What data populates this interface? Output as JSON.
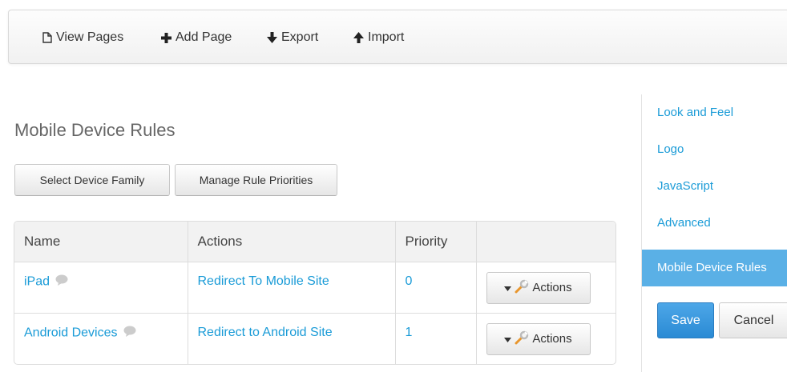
{
  "toolbar": {
    "view_pages": "View Pages",
    "add_page": "Add Page",
    "export": "Export",
    "import": "Import"
  },
  "page": {
    "title": "Mobile Device Rules",
    "select_device_family": "Select Device Family",
    "manage_rule_priorities": "Manage Rule Priorities"
  },
  "table": {
    "headers": [
      "Name",
      "Actions",
      "Priority",
      ""
    ],
    "rows": [
      {
        "name": "iPad",
        "action": "Redirect To Mobile Site",
        "priority": "0",
        "button": "Actions"
      },
      {
        "name": "Android Devices",
        "action": "Redirect to Android Site",
        "priority": "1",
        "button": "Actions"
      }
    ]
  },
  "sidebar": {
    "items": [
      {
        "label": "Look and Feel"
      },
      {
        "label": "Logo"
      },
      {
        "label": "JavaScript"
      },
      {
        "label": "Advanced"
      },
      {
        "label": "Mobile Device Rules",
        "active": true
      }
    ],
    "save": "Save",
    "cancel": "Cancel"
  },
  "colors": {
    "link": "#1a9bd7",
    "active_nav": "#5ab0e6",
    "primary_button": "#2a8ad4"
  },
  "icons": {
    "view_pages": "file-icon",
    "add_page": "plus-icon",
    "export": "arrow-down-icon",
    "import": "arrow-up-icon",
    "info_bubble": "speech-bubble-icon",
    "actions_caret": "caret-down-icon",
    "actions_tool": "wrench-icon"
  }
}
